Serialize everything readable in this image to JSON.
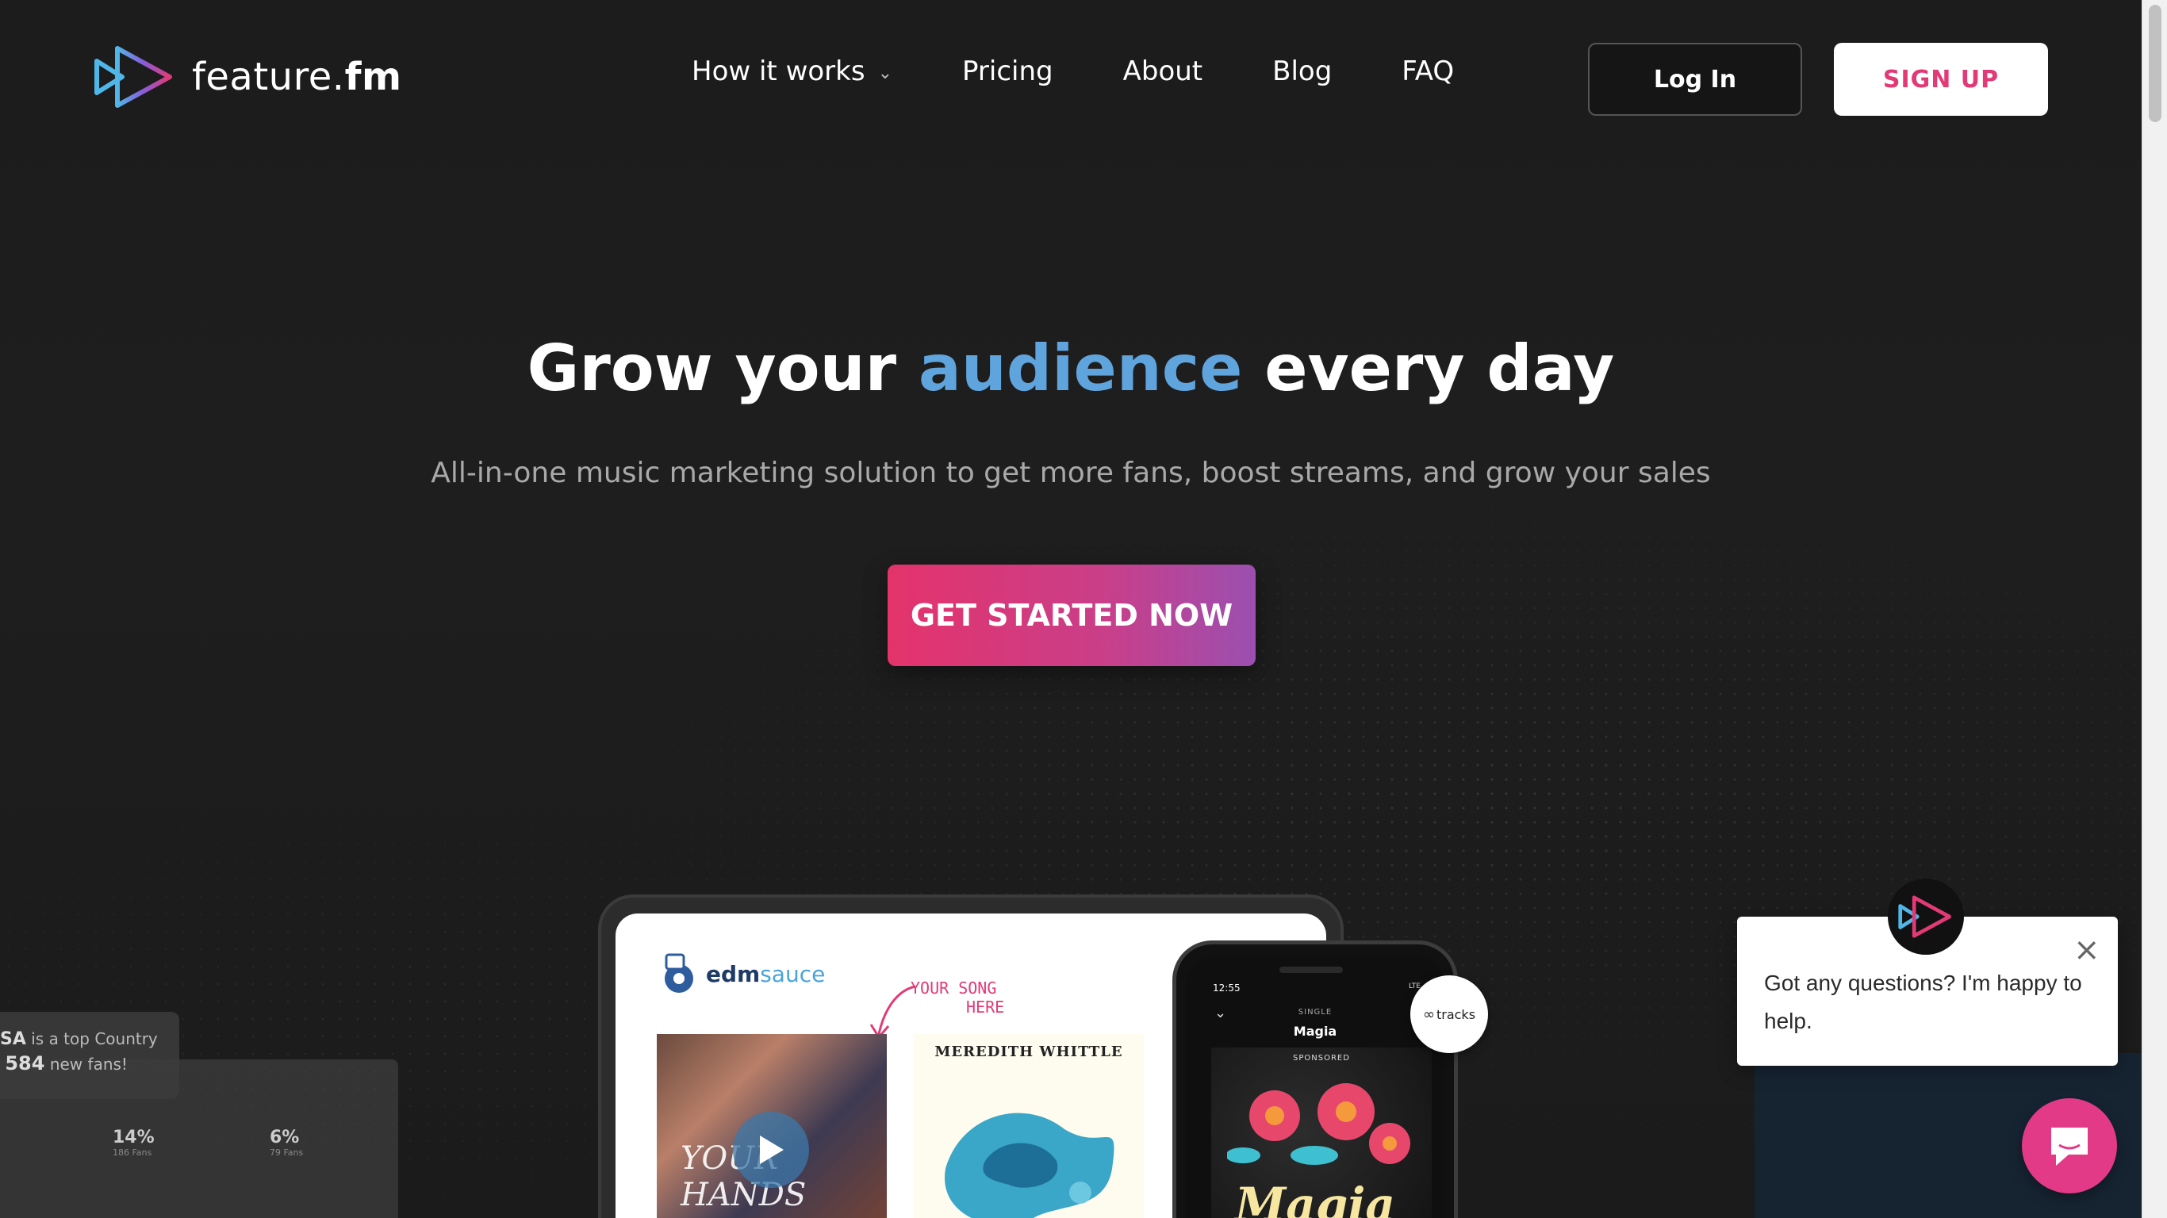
{
  "header": {
    "logo_text_plain": "feature.",
    "logo_text_bold": "fm",
    "nav": [
      {
        "label": "How it works",
        "has_dropdown": true
      },
      {
        "label": "Pricing"
      },
      {
        "label": "About"
      },
      {
        "label": "Blog"
      },
      {
        "label": "FAQ"
      }
    ],
    "login_label": "Log In",
    "signup_label": "SIGN UP"
  },
  "hero": {
    "title_pre": "Grow your",
    "title_accent": "audience",
    "title_post": "every day",
    "subtitle": "All-in-one music marketing solution to get more fans, boost streams, and grow your sales",
    "cta_label": "GET STARTED NOW"
  },
  "mockups": {
    "tablet": {
      "brand_main": "edm",
      "brand_accent": "sauce",
      "annotation_line1": "YOUR SONG",
      "annotation_line2": "HERE",
      "card1_text": "YOUR HANDS",
      "card2_title": "MEREDITH WHITTLE"
    },
    "phone": {
      "time": "12:55",
      "status": "LTE",
      "label": "SINGLE",
      "title": "Magia",
      "sponsored": "SPONSORED",
      "art_text": "Magia"
    },
    "tracks_badge": "tracks",
    "stats": {
      "country_prefix": "SA",
      "country_text": "is a top Country",
      "fans_count": "584",
      "fans_text": "new fans!",
      "items": [
        {
          "pct": "14%",
          "sub": "186 Fans"
        },
        {
          "pct": "6%",
          "sub": "79 Fans"
        }
      ]
    }
  },
  "chat": {
    "message": "Got any questions? I'm happy to help."
  },
  "colors": {
    "accent_blue": "#5fa4dd",
    "brand_pink": "#e23a76",
    "cta_gradient_start": "#e4336b",
    "cta_gradient_end": "#9b4fb0"
  }
}
